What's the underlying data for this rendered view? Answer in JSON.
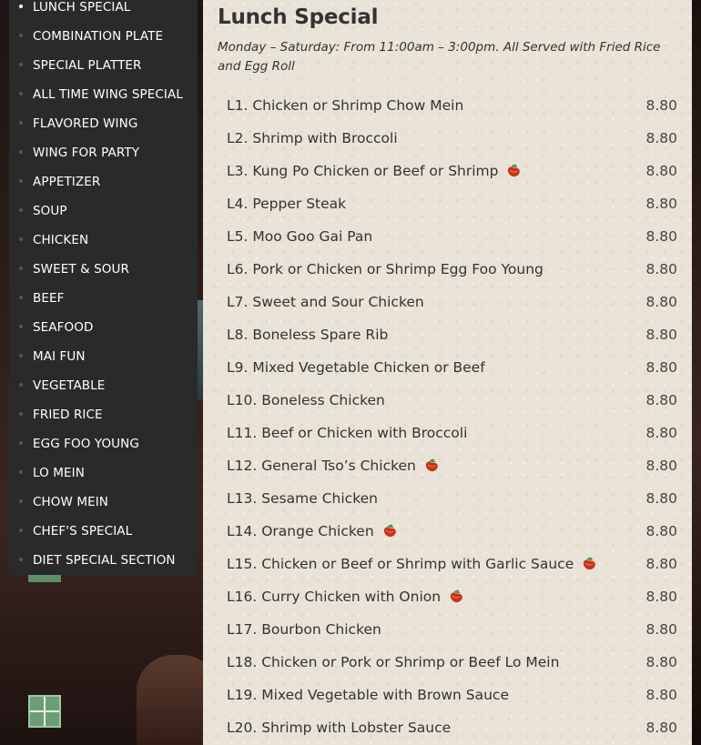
{
  "sidebar": {
    "items": [
      {
        "label": "LUNCH SPECIAL",
        "active": true
      },
      {
        "label": "COMBINATION PLATE"
      },
      {
        "label": "SPECIAL PLATTER"
      },
      {
        "label": "ALL TIME WING SPECIAL"
      },
      {
        "label": "FLAVORED WING"
      },
      {
        "label": "WING FOR PARTY"
      },
      {
        "label": "APPETIZER"
      },
      {
        "label": "SOUP"
      },
      {
        "label": "CHICKEN"
      },
      {
        "label": "SWEET & SOUR"
      },
      {
        "label": "BEEF"
      },
      {
        "label": "SEAFOOD"
      },
      {
        "label": "MAI FUN"
      },
      {
        "label": "VEGETABLE"
      },
      {
        "label": "FRIED RICE"
      },
      {
        "label": "EGG FOO YOUNG"
      },
      {
        "label": "LO MEIN"
      },
      {
        "label": "CHOW MEIN"
      },
      {
        "label": "CHEF'S SPECIAL"
      },
      {
        "label": "DIET SPECIAL SECTION"
      }
    ]
  },
  "section": {
    "title": "Lunch Special",
    "subtitle": "Monday – Saturday: From 11:00am – 3:00pm. All Served with Fried Rice and Egg Roll"
  },
  "menu": [
    {
      "name": "L1. Chicken or Shrimp Chow Mein",
      "price": "8.80",
      "spicy": false
    },
    {
      "name": "L2. Shrimp with Broccoli",
      "price": "8.80",
      "spicy": false
    },
    {
      "name": "L3. Kung Po Chicken or Beef or Shrimp",
      "price": "8.80",
      "spicy": true
    },
    {
      "name": "L4. Pepper Steak",
      "price": "8.80",
      "spicy": false
    },
    {
      "name": "L5. Moo Goo Gai Pan",
      "price": "8.80",
      "spicy": false
    },
    {
      "name": "L6. Pork or Chicken or Shrimp Egg Foo Young",
      "price": "8.80",
      "spicy": false
    },
    {
      "name": "L7. Sweet and Sour Chicken",
      "price": "8.80",
      "spicy": false
    },
    {
      "name": "L8. Boneless Spare Rib",
      "price": "8.80",
      "spicy": false
    },
    {
      "name": "L9. Mixed Vegetable Chicken or Beef",
      "price": "8.80",
      "spicy": false
    },
    {
      "name": "L10. Boneless Chicken",
      "price": "8.80",
      "spicy": false
    },
    {
      "name": "L11. Beef or Chicken with Broccoli",
      "price": "8.80",
      "spicy": false
    },
    {
      "name": "L12. General Tso’s Chicken",
      "price": "8.80",
      "spicy": true
    },
    {
      "name": "L13. Sesame Chicken",
      "price": "8.80",
      "spicy": false
    },
    {
      "name": "L14. Orange Chicken",
      "price": "8.80",
      "spicy": true
    },
    {
      "name": "L15. Chicken or Beef or Shrimp with Garlic Sauce",
      "price": "8.80",
      "spicy": true
    },
    {
      "name": "L16. Curry Chicken with Onion",
      "price": "8.80",
      "spicy": true
    },
    {
      "name": "L17. Bourbon Chicken",
      "price": "8.80",
      "spicy": false
    },
    {
      "name": "L18. Chicken or Pork or Shrimp or Beef Lo Mein",
      "price": "8.80",
      "spicy": false
    },
    {
      "name": "L19. Mixed Vegetable with Brown Sauce",
      "price": "8.80",
      "spicy": false
    },
    {
      "name": "L20. Shrimp with Lobster Sauce",
      "price": "8.80",
      "spicy": false
    }
  ],
  "icons": {
    "spicy": "chili-pepper-icon"
  },
  "colors": {
    "sidebar_bg": "#2a2a2a",
    "panel_bg": "#e9e2d7",
    "pepper": "#c8321e"
  }
}
